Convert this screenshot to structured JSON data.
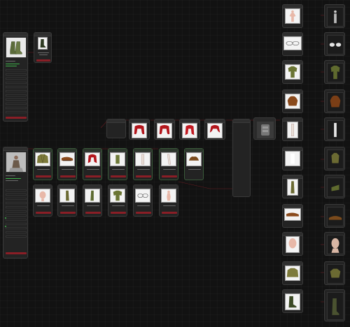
{
  "canvas": {
    "background": "#121212",
    "accent": "#8a1e26",
    "wire_color": "#8a1e26"
  },
  "left_top_panel": {
    "status_text": "",
    "fields": [
      "",
      "",
      "",
      "",
      "",
      "",
      "",
      "",
      ""
    ]
  },
  "left_bottom_panel": {
    "status_text": "",
    "fields": [
      "",
      "",
      "",
      "",
      "",
      "",
      "",
      "",
      "",
      "",
      "",
      ""
    ]
  },
  "left_top_output": {
    "button_label": ""
  },
  "hair_row": {
    "items": [
      "hair-red-1",
      "hair-red-2",
      "hair-red-3",
      "hair-red-4"
    ]
  },
  "grid_row1": {
    "items": [
      "jacket-camo",
      "shoes-brown",
      "hair-red",
      "shirt-green",
      "pants-white",
      "legs-white",
      "shoes-brown-2"
    ]
  },
  "grid_row2": {
    "items": [
      "head-base",
      "arm-camo",
      "arm-camo-2",
      "shirt-camo",
      "glasses",
      "body-base"
    ]
  },
  "right_inputs": {
    "items": [
      "body-base",
      "glasses",
      "shirt-camo",
      "shoes-brown",
      "pants-white",
      "shirt-green",
      "arm-camo",
      "shoes-brown-2",
      "head-base",
      "jacket-camo",
      "boots-green"
    ]
  },
  "right_previews": {
    "items": [
      "figure-render",
      "glasses-render",
      "shirt-render",
      "hair-render",
      "legs-render",
      "torso-render",
      "arm-render",
      "shoes-render",
      "head-render",
      "jacket-render",
      "boots-render"
    ]
  },
  "center_node": {
    "preview": "mesh-render"
  }
}
